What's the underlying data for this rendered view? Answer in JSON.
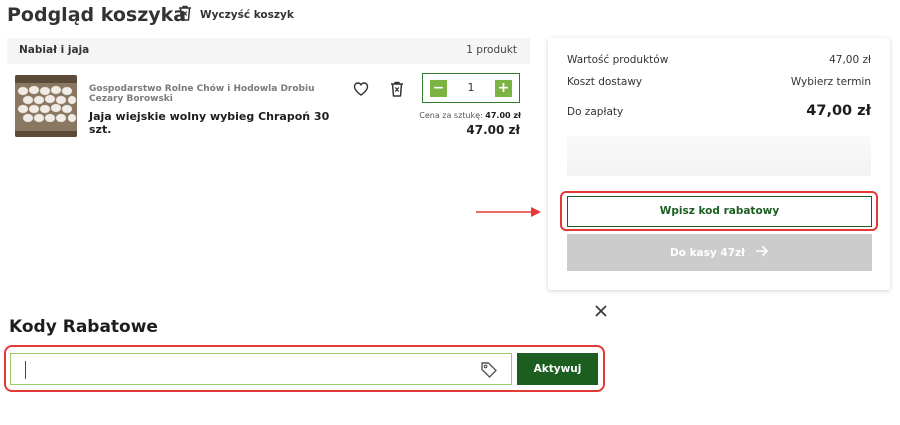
{
  "page": {
    "title": "Podgląd koszyka",
    "clear_cart_label": "Wyczyść koszyk"
  },
  "cart": {
    "category": "Nabiał i jaja",
    "count_label": "1 produkt",
    "items": [
      {
        "producer": "Gospodarstwo Rolne Chów i Hodowla Drobiu Cezary Borowski",
        "name": "Jaja wiejskie wolny wybieg Chrapoń 30 szt.",
        "quantity": "1",
        "minus_label": "−",
        "plus_label": "+",
        "unit_price_label": "Cena za sztukę:",
        "unit_price_value": "47.00 zł",
        "total": "47.00 zł"
      }
    ]
  },
  "summary": {
    "products_value_label": "Wartość produktów",
    "products_value": "47,00 zł",
    "delivery_label": "Koszt dostawy",
    "delivery_value": "Wybierz termin",
    "to_pay_label": "Do zapłaty",
    "to_pay_value": "47,00 zł",
    "promo_button": "Wpisz kod rabatowy",
    "checkout_button": "Do kasy 47zł",
    "checkout_enabled": false
  },
  "discount_panel": {
    "title": "Kody Rabatowe",
    "input_value": "",
    "input_placeholder": "",
    "activate_button": "Aktywuj"
  },
  "colors": {
    "brand_green": "#1b5e20",
    "qty_green": "#7cb342",
    "annotation_red": "#e53935",
    "disabled_gray": "#cccccc"
  },
  "icons": {
    "clear_cart": "trash-icon",
    "favorite": "heart-icon",
    "remove": "trash-icon",
    "checkout_arrow": "arrow-right-icon",
    "close": "close-icon",
    "tag": "tag-icon"
  }
}
